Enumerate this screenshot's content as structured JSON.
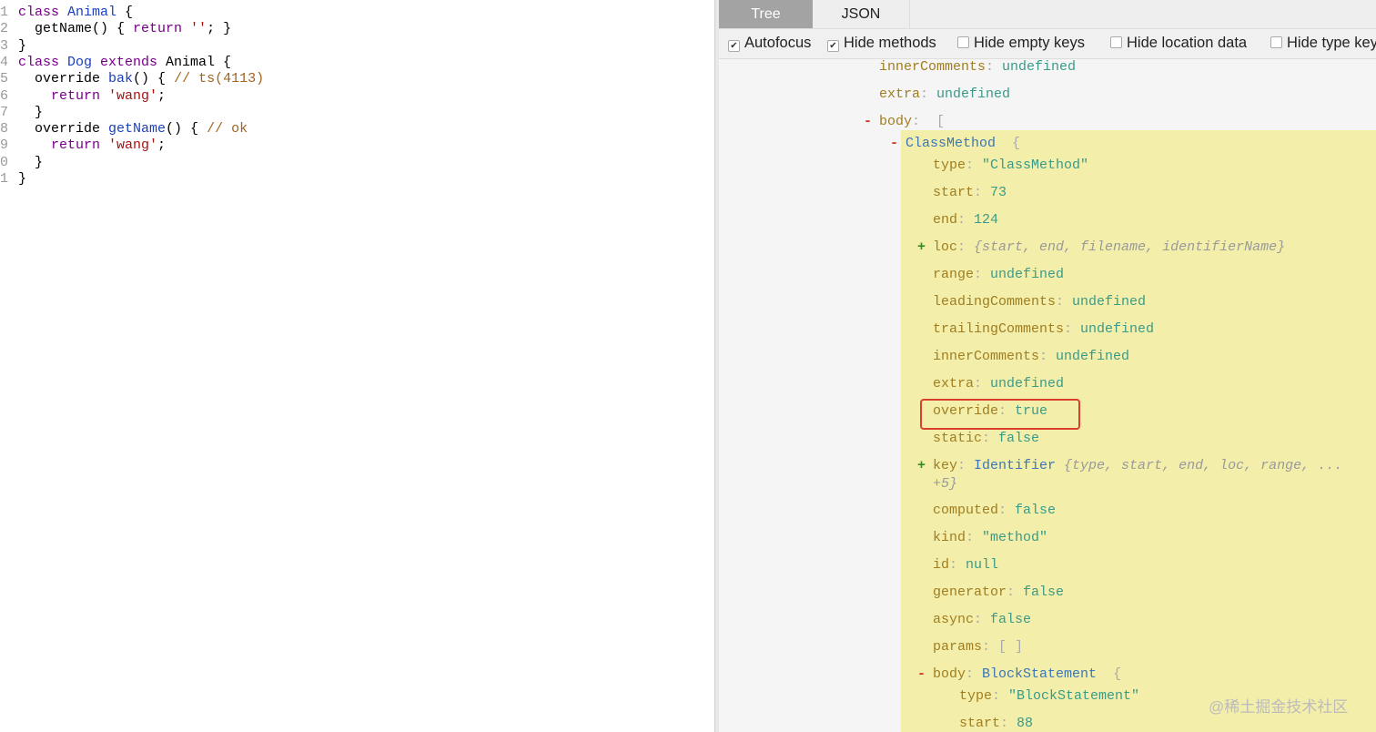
{
  "editor": {
    "lines": [
      {
        "n": "1",
        "tokens": [
          [
            "kw",
            "class "
          ],
          [
            "def",
            "Animal"
          ],
          [
            "pl",
            " {"
          ]
        ]
      },
      {
        "n": "2",
        "tokens": [
          [
            "pl",
            "  getName() { "
          ],
          [
            "kw",
            "return"
          ],
          [
            "str",
            " ''"
          ],
          [
            "pl",
            "; }"
          ]
        ]
      },
      {
        "n": "3",
        "tokens": [
          [
            "pl",
            "}"
          ]
        ]
      },
      {
        "n": "4",
        "tokens": [
          [
            "kw",
            "class "
          ],
          [
            "def",
            "Dog"
          ],
          [
            "kw",
            " extends "
          ],
          [
            "pl",
            "Animal {"
          ]
        ]
      },
      {
        "n": "5",
        "tokens": [
          [
            "pl",
            "  override "
          ],
          [
            "def",
            "bak"
          ],
          [
            "pl",
            "() { "
          ],
          [
            "cm",
            "// ts(4113)"
          ]
        ]
      },
      {
        "n": "6",
        "tokens": [
          [
            "kw",
            "    return "
          ],
          [
            "str",
            "'wang'"
          ],
          [
            "pl",
            ";"
          ]
        ]
      },
      {
        "n": "7",
        "tokens": [
          [
            "pl",
            "  }"
          ]
        ]
      },
      {
        "n": "8",
        "tokens": [
          [
            "pl",
            "  override "
          ],
          [
            "def",
            "getName"
          ],
          [
            "pl",
            "() { "
          ],
          [
            "cm",
            "// ok"
          ]
        ]
      },
      {
        "n": "9",
        "tokens": [
          [
            "kw",
            "    return "
          ],
          [
            "str",
            "'wang'"
          ],
          [
            "pl",
            ";"
          ]
        ]
      },
      {
        "n": "0",
        "tokens": [
          [
            "pl",
            "  }"
          ]
        ]
      },
      {
        "n": "1",
        "tokens": [
          [
            "pl",
            "}"
          ]
        ]
      }
    ]
  },
  "tabs": {
    "tree": "Tree",
    "json": "JSON"
  },
  "options": [
    {
      "label": "Autofocus",
      "checked": true
    },
    {
      "label": "Hide methods",
      "checked": true
    },
    {
      "label": "Hide empty keys",
      "checked": false
    },
    {
      "label": "Hide location data",
      "checked": false
    },
    {
      "label": "Hide type keys",
      "checked": false
    }
  ],
  "tree": [
    {
      "level": 0,
      "toggle": "",
      "key": "innerComments",
      "val": "undefined",
      "vc": "v"
    },
    {
      "level": 0,
      "toggle": "",
      "key": "extra",
      "val": "undefined",
      "vc": "v"
    },
    {
      "level": 0,
      "toggle": "-",
      "key": "body",
      "val": " [",
      "vc": "p"
    },
    {
      "level": 1,
      "toggle": "-",
      "key": "",
      "val": "ClassMethod",
      "vc": "t",
      "suffix": "  {"
    },
    {
      "level": 2,
      "toggle": "",
      "key": "type",
      "val": "\"ClassMethod\"",
      "vc": "v"
    },
    {
      "level": 2,
      "toggle": "",
      "key": "start",
      "val": "73",
      "vc": "v"
    },
    {
      "level": 2,
      "toggle": "",
      "key": "end",
      "val": "124",
      "vc": "v"
    },
    {
      "level": 2,
      "toggle": "+",
      "key": "loc",
      "val": "{start, end, filename, identifierName}",
      "vc": "g"
    },
    {
      "level": 2,
      "toggle": "",
      "key": "range",
      "val": "undefined",
      "vc": "v"
    },
    {
      "level": 2,
      "toggle": "",
      "key": "leadingComments",
      "val": "undefined",
      "vc": "v"
    },
    {
      "level": 2,
      "toggle": "",
      "key": "trailingComments",
      "val": "undefined",
      "vc": "v"
    },
    {
      "level": 2,
      "toggle": "",
      "key": "innerComments",
      "val": "undefined",
      "vc": "v"
    },
    {
      "level": 2,
      "toggle": "",
      "key": "extra",
      "val": "undefined",
      "vc": "v"
    },
    {
      "level": 2,
      "toggle": "",
      "key": "override",
      "val": "true",
      "vc": "v"
    },
    {
      "level": 2,
      "toggle": "",
      "key": "static",
      "val": "false",
      "vc": "v"
    },
    {
      "level": 2,
      "toggle": "+",
      "key": "key",
      "val": "Identifier",
      "vc": "t",
      "suffix": " {type, start, end, loc, range, ...",
      "wrap": "+5}"
    },
    {
      "level": 2,
      "toggle": "",
      "key": "computed",
      "val": "false",
      "vc": "v"
    },
    {
      "level": 2,
      "toggle": "",
      "key": "kind",
      "val": "\"method\"",
      "vc": "v"
    },
    {
      "level": 2,
      "toggle": "",
      "key": "id",
      "val": "null",
      "vc": "v"
    },
    {
      "level": 2,
      "toggle": "",
      "key": "generator",
      "val": "false",
      "vc": "v"
    },
    {
      "level": 2,
      "toggle": "",
      "key": "async",
      "val": "false",
      "vc": "v"
    },
    {
      "level": 2,
      "toggle": "",
      "key": "params",
      "val": "[ ]",
      "vc": "p"
    },
    {
      "level": 2,
      "toggle": "-",
      "key": "body",
      "val": "BlockStatement",
      "vc": "t",
      "suffix": "  {"
    },
    {
      "level": 3,
      "toggle": "",
      "key": "type",
      "val": "\"BlockStatement\"",
      "vc": "v"
    },
    {
      "level": 3,
      "toggle": "",
      "key": "start",
      "val": "88",
      "vc": "v"
    }
  ],
  "watermark": "@稀土掘金技术社区"
}
